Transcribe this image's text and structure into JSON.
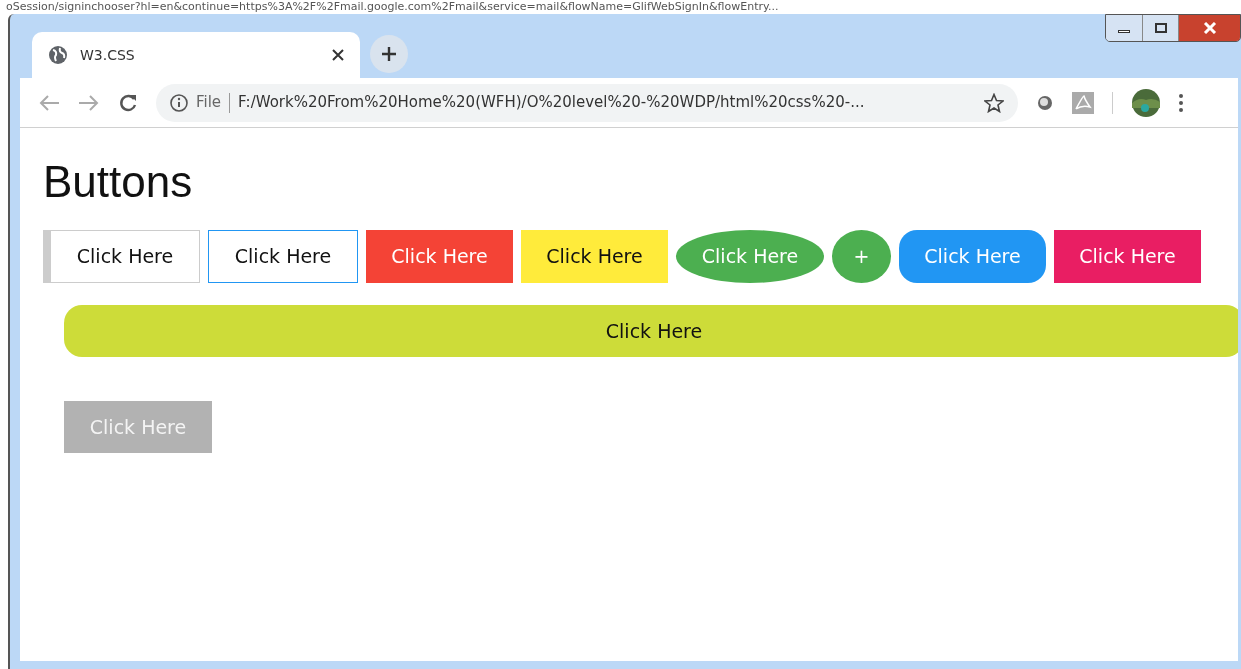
{
  "background_text": "oSession/signinchooser?hl=en&continue=https%3A%2F%2Fmail.google.com%2Fmail&service=mail&flowName=GlifWebSignIn&flowEntry...",
  "tab": {
    "title": "W3.CSS",
    "selected": true
  },
  "address_bar": {
    "scheme": "File",
    "url": "F:/Work%20From%20Home%20(WFH)/O%20level%20-%20WDP/html%20css%20-..."
  },
  "page": {
    "heading": "Buttons",
    "buttons": [
      {
        "kind": "leftbar",
        "label": "Click Here",
        "color": "#ffffff"
      },
      {
        "kind": "outline",
        "label": "Click Here",
        "color": "#ffffff"
      },
      {
        "kind": "flat",
        "label": "Click Here",
        "color": "#f44336"
      },
      {
        "kind": "flat",
        "label": "Click Here",
        "color": "#ffeb3b"
      },
      {
        "kind": "ellipse",
        "label": "Click Here",
        "color": "#4caf50"
      },
      {
        "kind": "circle",
        "label": "+",
        "color": "#4caf50"
      },
      {
        "kind": "round",
        "label": "Click Here",
        "color": "#2196f3"
      },
      {
        "kind": "flat",
        "label": "Click Here",
        "color": "#e91e63"
      }
    ],
    "wide_button": {
      "label": "Click Here",
      "color": "#cddc39"
    },
    "disabled_button": {
      "label": "Click Here",
      "disabled": true
    }
  }
}
